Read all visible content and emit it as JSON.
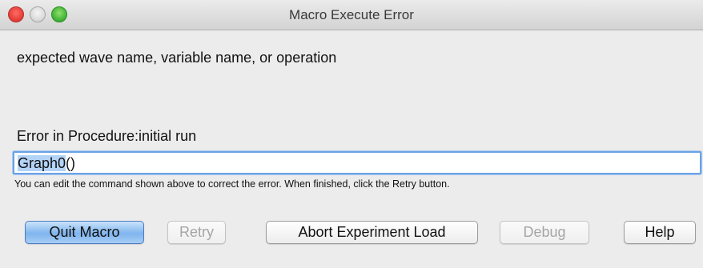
{
  "window": {
    "title": "Macro Execute Error"
  },
  "message": "expected wave name, variable name, or operation",
  "procedure_label": "Error in Procedure:initial run",
  "command": {
    "selected": "Graph0",
    "rest": "()"
  },
  "hint": "You can edit the command shown above to correct the error. When finished, click the Retry button.",
  "buttons": {
    "quit": "Quit Macro",
    "retry": "Retry",
    "abort": "Abort Experiment Load",
    "debug": "Debug",
    "help": "Help"
  },
  "colors": {
    "close": "#e7403a",
    "maximize": "#47b63a",
    "accent": "#6aa3e6"
  }
}
